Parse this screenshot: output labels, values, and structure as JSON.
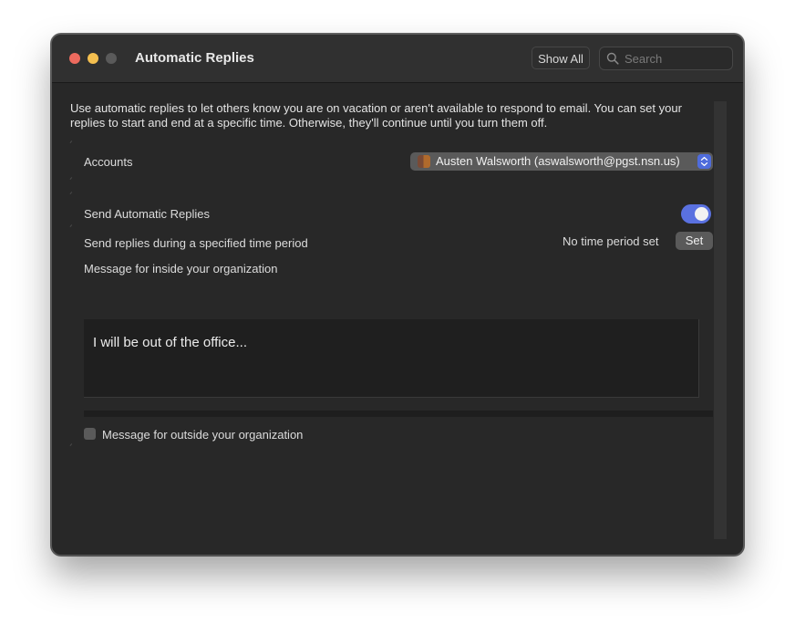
{
  "window": {
    "title": "Automatic Replies",
    "show_all_label": "Show All",
    "search_placeholder": "Search"
  },
  "description": "Use automatic replies to let others know you are on vacation or aren't available to respond to email. You can set your replies to start and end at a specific time. Otherwise, they'll continue until you turn them off.",
  "accounts": {
    "label": "Accounts",
    "selected": "Austen Walsworth (aswalsworth@pgst.nsn.us)"
  },
  "send_auto": {
    "label": "Send Automatic Replies",
    "enabled": true
  },
  "time_period": {
    "label": "Send replies during a specified time period",
    "status": "No time period set",
    "set_label": "Set"
  },
  "inside": {
    "label": "Message for inside your organization",
    "message": "I will be out of the office..."
  },
  "outside": {
    "label": "Message for outside your organization",
    "checked": false
  },
  "colors": {
    "accent": "#5a71e0",
    "window_bg": "#282828",
    "close": "#ed6a5e",
    "minimize": "#f4bf4f"
  }
}
